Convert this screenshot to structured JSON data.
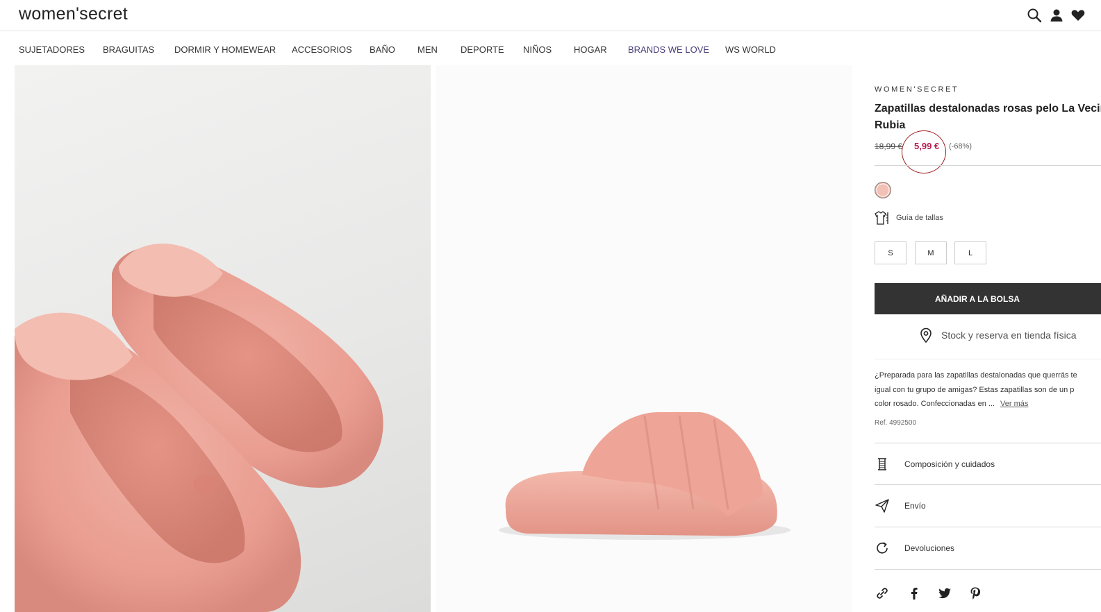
{
  "header": {
    "logo": "women'secret",
    "icons": [
      "search-icon",
      "user-icon",
      "heart-icon"
    ]
  },
  "nav": {
    "items": [
      "SUJETADORES",
      "BRAGUITAS",
      "DORMIR Y HOMEWEAR",
      "ACCESORIOS",
      "BAÑO",
      "MEN",
      "DEPORTE",
      "NIÑOS",
      "HOGAR",
      "BRANDS WE LOVE",
      "WS WORLD"
    ]
  },
  "product": {
    "brand": "WOMEN'SECRET",
    "title": "Zapatillas destalonadas rosas pelo La Vecina Rubia",
    "price_old": "18,99 €",
    "price_new": "5,99 €",
    "discount": "(-68%)",
    "swatch_color": "#f2c0b4",
    "size_guide": "Guía de tallas",
    "sizes": [
      "S",
      "M",
      "L"
    ],
    "add_to_bag": "AÑADIR A LA BOLSA",
    "store_stock": "Stock y reserva en tienda física",
    "description_lines": [
      "¿Preparada para las zapatillas destalonadas que querrás te",
      "igual con tu grupo de amigas? Estas zapatillas son de un p",
      "color rosado. Confeccionadas en ..."
    ],
    "ver_mas": "Ver más",
    "ref": "Ref. 4992500",
    "accordion": [
      "Composición y cuidados",
      "Envío",
      "Devoluciones"
    ],
    "share_icons": [
      "link-icon",
      "facebook-icon",
      "twitter-icon",
      "pinterest-icon"
    ]
  },
  "colors": {
    "sale_price": "#b31e52",
    "primary_button": "#333333",
    "brand_nav": "#4a3d7a",
    "slipper_pink": "#eba497"
  }
}
